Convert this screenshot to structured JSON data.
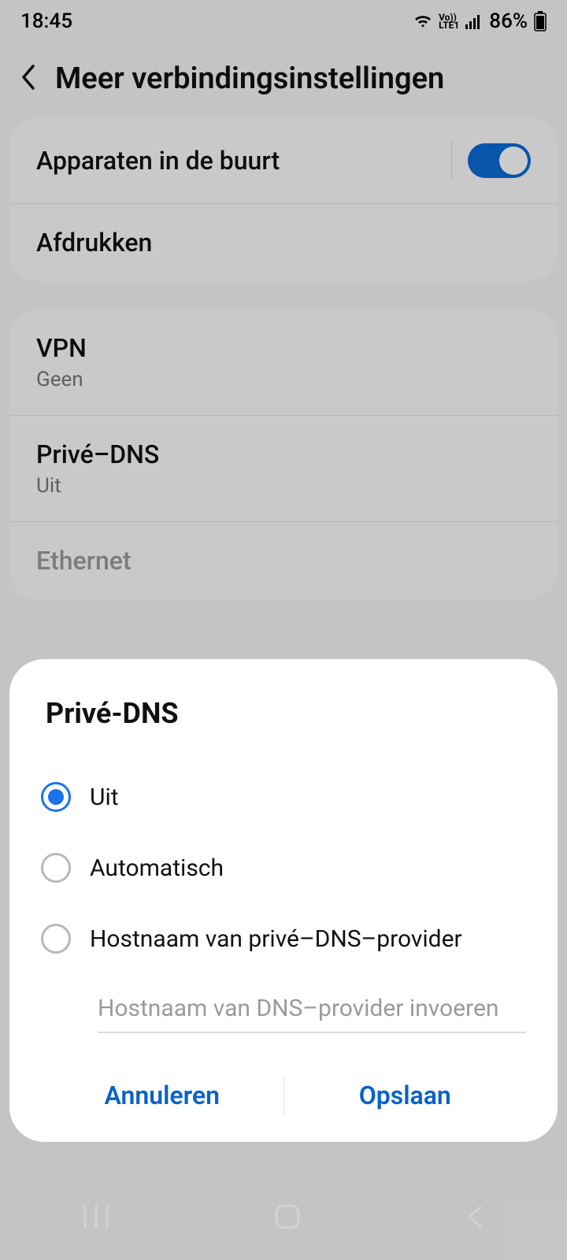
{
  "status": {
    "time": "18:45",
    "battery": "86%"
  },
  "header": {
    "title": "Meer verbindingsinstellingen"
  },
  "groups": [
    {
      "rows": [
        {
          "title": "Apparaten in de buurt",
          "toggle": true
        },
        {
          "title": "Afdrukken"
        }
      ]
    },
    {
      "rows": [
        {
          "title": "VPN",
          "sub": "Geen"
        },
        {
          "title": "Privé–DNS",
          "sub": "Uit"
        },
        {
          "title": "Ethernet",
          "disabled": true
        }
      ]
    }
  ],
  "dialog": {
    "title": "Privé-DNS",
    "options": [
      {
        "label": "Uit",
        "selected": true
      },
      {
        "label": "Automatisch",
        "selected": false
      },
      {
        "label": "Hostnaam van privé–DNS–provider",
        "selected": false
      }
    ],
    "hostname_placeholder": "Hostnaam van DNS–provider invoeren",
    "cancel": "Annuleren",
    "save": "Opslaan"
  }
}
